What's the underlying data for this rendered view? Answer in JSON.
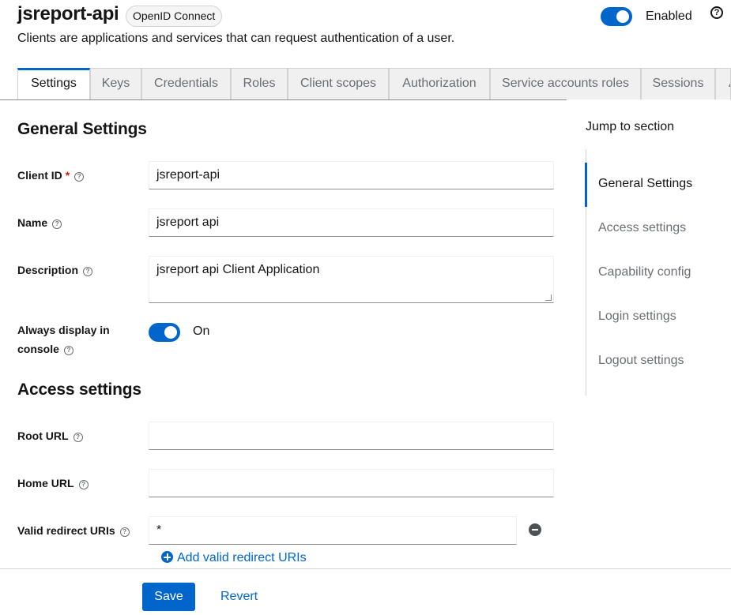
{
  "header": {
    "title": "jsreport-api",
    "protocol_badge": "OpenID Connect",
    "subtitle": "Clients are applications and services that can request authentication of a user.",
    "enabled_label": "Enabled",
    "enabled": true,
    "help_glyph": "?"
  },
  "tabs": [
    {
      "label": "Settings",
      "active": true
    },
    {
      "label": "Keys"
    },
    {
      "label": "Credentials"
    },
    {
      "label": "Roles"
    },
    {
      "label": "Client scopes"
    },
    {
      "label": "Authorization"
    },
    {
      "label": "Service accounts roles"
    },
    {
      "label": "Sessions"
    },
    {
      "label": "A"
    }
  ],
  "general": {
    "title": "General Settings",
    "client_id_label": "Client ID",
    "required_mark": "*",
    "client_id_value": "jsreport-api",
    "name_label": "Name",
    "name_value": "jsreport api",
    "description_label": "Description",
    "description_value": "jsreport api Client Application",
    "always_display_label": "Always display in console",
    "always_display_on": true,
    "on_label": "On"
  },
  "access": {
    "title": "Access settings",
    "root_url_label": "Root URL",
    "root_url_value": "",
    "home_url_label": "Home URL",
    "home_url_value": "",
    "redirect_label": "Valid redirect URIs",
    "redirect_value": "*",
    "add_redirect_label": "Add valid redirect URIs"
  },
  "jump": {
    "title": "Jump to section",
    "items": [
      {
        "label": "General Settings",
        "active": true
      },
      {
        "label": "Access settings"
      },
      {
        "label": "Capability config"
      },
      {
        "label": "Login settings"
      },
      {
        "label": "Logout settings"
      }
    ]
  },
  "footer": {
    "save_label": "Save",
    "revert_label": "Revert"
  },
  "icons": {
    "help": "question-circle-icon",
    "remove": "minus-circle-icon",
    "add": "plus-circle-icon"
  },
  "colors": {
    "accent": "#0066cc",
    "required": "#c9190b"
  }
}
